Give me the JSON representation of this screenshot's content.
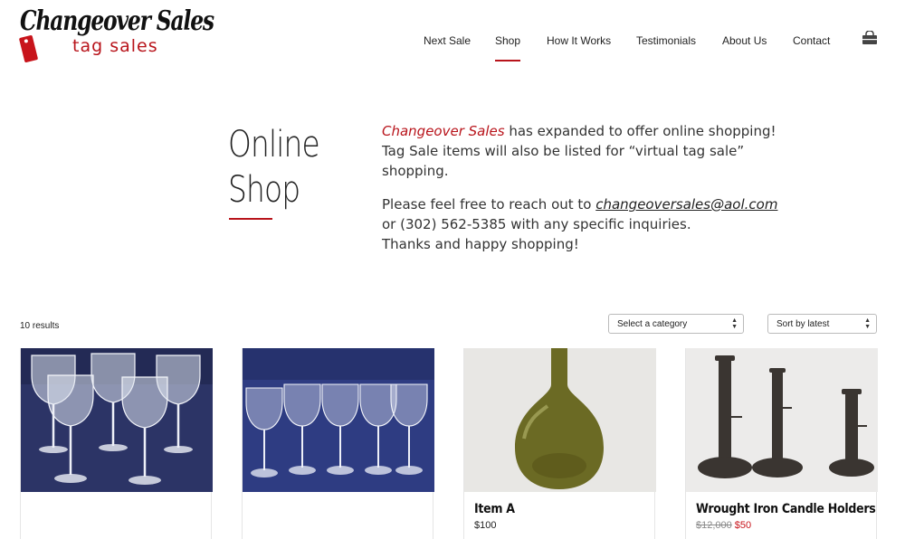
{
  "header": {
    "logo_script": "Changeover Sales",
    "logo_sub": "tag sales"
  },
  "nav": {
    "items": [
      {
        "label": "Next Sale",
        "active": false
      },
      {
        "label": "Shop",
        "active": true
      },
      {
        "label": "How It Works",
        "active": false
      },
      {
        "label": "Testimonials",
        "active": false
      },
      {
        "label": "About Us",
        "active": false
      },
      {
        "label": "Contact",
        "active": false
      }
    ],
    "cart_icon": "shopping-bag-icon"
  },
  "intro": {
    "title_line1": "Online",
    "title_line2": "Shop",
    "brand": "Changeover Sales",
    "p1_rest": " has expanded to offer online shopping!",
    "p1_line2": "Tag Sale items will also be listed for “virtual tag sale” shopping.",
    "p2_lead": "Please feel free to reach out to ",
    "email": "changeoversales@aol.com",
    "p2_line2": "or (302) 562-5385 with any specific inquiries.",
    "p2_line3": "Thanks and happy shopping!"
  },
  "toolbar": {
    "results": "10 results",
    "category_select": "Select a category",
    "sort_select": "Sort by latest"
  },
  "products": [
    {
      "name": "",
      "price": "",
      "image": "crystal-wine-glasses"
    },
    {
      "name": "",
      "price": "",
      "image": "crystal-stemware-set"
    },
    {
      "name": "Item A",
      "price": "$100",
      "image": "green-glass-bottle"
    },
    {
      "name": "Wrought Iron Candle Holders",
      "price_old": "$12,000",
      "price": "$50",
      "image": "iron-candle-holders"
    }
  ],
  "colors": {
    "accent": "#b8141b",
    "sale": "#c8141b"
  }
}
